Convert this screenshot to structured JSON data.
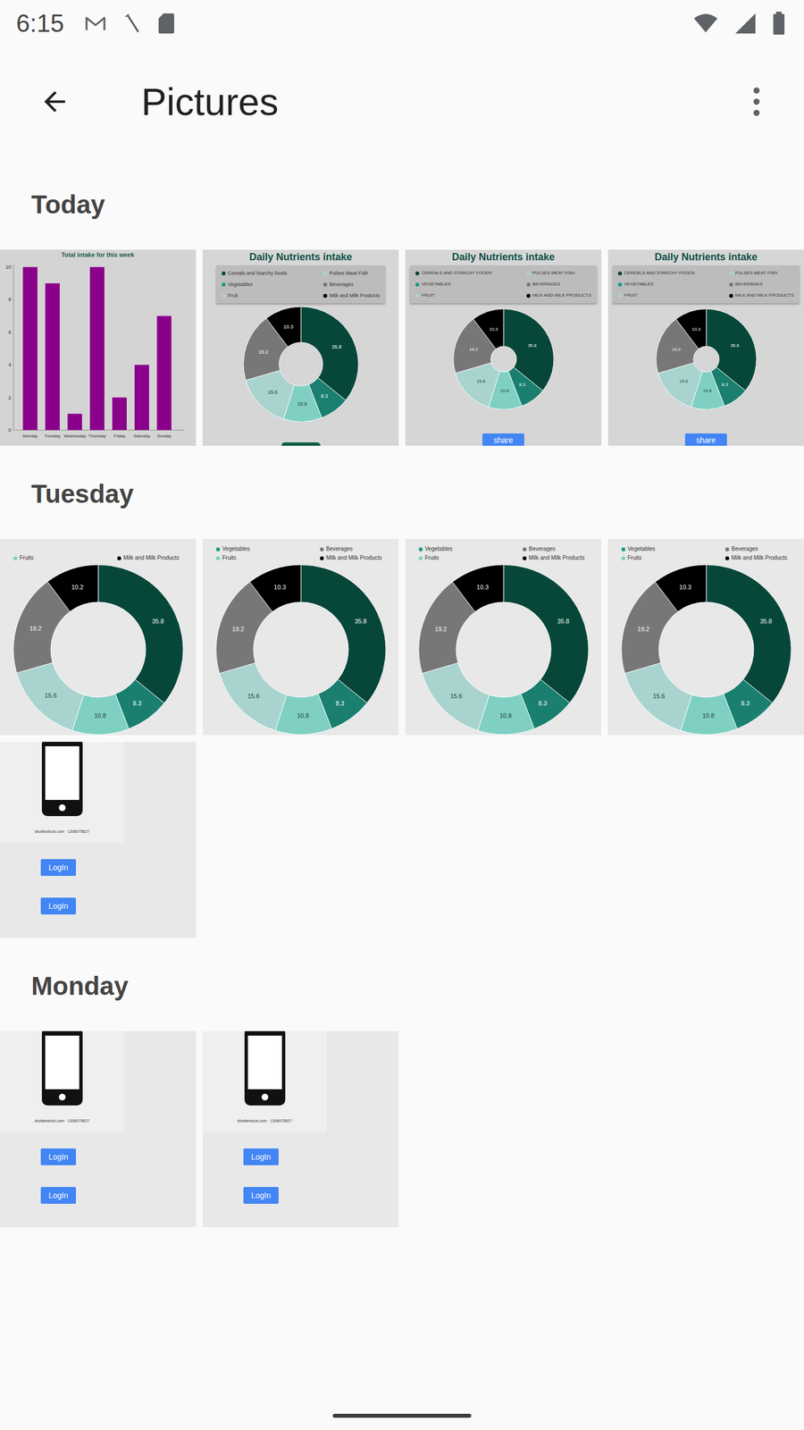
{
  "status_bar": {
    "time": "6:15"
  },
  "toolbar": {
    "title": "Pictures"
  },
  "sections": [
    {
      "title": "Today",
      "items": [
        {
          "kind": "bar-chart",
          "title": "Total intake for this week",
          "y_ticks": [
            "0",
            "2",
            "4",
            "6",
            "8",
            "10"
          ],
          "days": [
            "Monday",
            "Tuesday",
            "Wednesday",
            "Thursday",
            "Friday",
            "Saturday",
            "Sunday"
          ],
          "values": [
            10,
            9,
            1,
            10,
            2,
            4,
            7
          ]
        },
        {
          "kind": "donut-card",
          "title": "Daily Nutrients intake",
          "legend": [
            {
              "label": "Cereals and Starchy foods",
              "color": "#07473a"
            },
            {
              "label": "Pulses Meat Fish",
              "color": "#a9d3cf"
            },
            {
              "label": "Vegetables",
              "color": "#1a9a88"
            },
            {
              "label": "Beverages",
              "color": "#777777"
            },
            {
              "label": "Fruit",
              "color": "#a9d3cf"
            },
            {
              "label": "Milk and Milk Products",
              "color": "#000000"
            }
          ],
          "slices": [
            {
              "value": 35.8,
              "label": "35.8",
              "color": "#07473a"
            },
            {
              "value": 8.3,
              "label": "8.3",
              "color": "#1a7f6f"
            },
            {
              "value": 10.8,
              "label": "10.8",
              "color": "#7fd0c3"
            },
            {
              "value": 15.6,
              "label": "15.6",
              "color": "#a9d3cf"
            },
            {
              "value": 19.2,
              "label": "19.2",
              "color": "#777777"
            },
            {
              "value": 10.3,
              "label": "10.3",
              "color": "#000000"
            }
          ]
        },
        {
          "kind": "donut-share",
          "title": "Daily Nutrients intake",
          "legend": [
            {
              "label": "CEREALS AND STARCHY FOODS",
              "color": "#07473a"
            },
            {
              "label": "PULSES MEAT FISH",
              "color": "#a9d3cf"
            },
            {
              "label": "VEGETABLES",
              "color": "#1a9a88"
            },
            {
              "label": "BEVERAGES",
              "color": "#777777"
            },
            {
              "label": "FRUIT",
              "color": "#a9d3cf"
            },
            {
              "label": "MILK AND MILK PRODUCTS",
              "color": "#000000"
            }
          ],
          "slices": [
            {
              "value": 35.8,
              "label": "35.8",
              "color": "#07473a"
            },
            {
              "value": 8.3,
              "label": "8.3",
              "color": "#1a7f6f"
            },
            {
              "value": 10.8,
              "label": "10.8",
              "color": "#7fd0c3"
            },
            {
              "value": 15.6,
              "label": "15.6",
              "color": "#a9d3cf"
            },
            {
              "value": 19.2,
              "label": "19.2",
              "color": "#777777"
            },
            {
              "value": 10.3,
              "label": "10.3",
              "color": "#000000"
            }
          ],
          "button": "share"
        },
        {
          "kind": "donut-share",
          "title": "Daily Nutrients intake",
          "legend": [
            {
              "label": "CEREALS AND STARCHY FOODS",
              "color": "#07473a"
            },
            {
              "label": "PULSES MEAT FISH",
              "color": "#a9d3cf"
            },
            {
              "label": "VEGETABLES",
              "color": "#1a9a88"
            },
            {
              "label": "BEVERAGES",
              "color": "#777777"
            },
            {
              "label": "FRUIT",
              "color": "#a9d3cf"
            },
            {
              "label": "MILK AND MILK PRODUCTS",
              "color": "#000000"
            }
          ],
          "slices": [
            {
              "value": 35.8,
              "label": "35.8",
              "color": "#07473a"
            },
            {
              "value": 8.3,
              "label": "8.3",
              "color": "#1a7f6f"
            },
            {
              "value": 10.8,
              "label": "10.8",
              "color": "#7fd0c3"
            },
            {
              "value": 15.6,
              "label": "15.6",
              "color": "#a9d3cf"
            },
            {
              "value": 19.2,
              "label": "19.2",
              "color": "#777777"
            },
            {
              "value": 10.3,
              "label": "10.3",
              "color": "#000000"
            }
          ],
          "button": "share"
        }
      ]
    },
    {
      "title": "Tuesday",
      "items": [
        {
          "kind": "donut-zoom",
          "legend": [
            {
              "label": "Fruits",
              "color": "#7fd0c3"
            },
            {
              "label": "Milk and Milk Products",
              "color": "#000000"
            }
          ],
          "slices": [
            {
              "value": 35.8,
              "label": "35.8",
              "color": "#07473a"
            },
            {
              "value": 8.3,
              "label": "8.3",
              "color": "#1a7f6f"
            },
            {
              "value": 10.8,
              "label": "10.8",
              "color": "#7fd0c3"
            },
            {
              "value": 15.6,
              "label": "15.6",
              "color": "#a9d3cf"
            },
            {
              "value": 19.2,
              "label": "19.2",
              "color": "#777777"
            },
            {
              "value": 10.2,
              "label": "10.2",
              "color": "#000000"
            }
          ]
        },
        {
          "kind": "donut-zoom",
          "legend": [
            {
              "label": "Vegetables",
              "color": "#1a9a88"
            },
            {
              "label": "Beverages",
              "color": "#777777"
            },
            {
              "label": "Fruits",
              "color": "#7fd0c3"
            },
            {
              "label": "Milk and Milk Products",
              "color": "#000000"
            }
          ],
          "slices": [
            {
              "value": 35.8,
              "label": "35.8",
              "color": "#07473a"
            },
            {
              "value": 8.3,
              "label": "8.3",
              "color": "#1a7f6f"
            },
            {
              "value": 10.8,
              "label": "10.8",
              "color": "#7fd0c3"
            },
            {
              "value": 15.6,
              "label": "15.6",
              "color": "#a9d3cf"
            },
            {
              "value": 19.2,
              "label": "19.2",
              "color": "#777777"
            },
            {
              "value": 10.3,
              "label": "10.3",
              "color": "#000000"
            }
          ]
        },
        {
          "kind": "donut-zoom",
          "legend": [
            {
              "label": "Vegetables",
              "color": "#1a9a88"
            },
            {
              "label": "Beverages",
              "color": "#777777"
            },
            {
              "label": "Fruits",
              "color": "#7fd0c3"
            },
            {
              "label": "Milk and Milk Products",
              "color": "#000000"
            }
          ],
          "slices": [
            {
              "value": 35.8,
              "label": "35.8",
              "color": "#07473a"
            },
            {
              "value": 8.3,
              "label": "8.3",
              "color": "#1a7f6f"
            },
            {
              "value": 10.8,
              "label": "10.8",
              "color": "#7fd0c3"
            },
            {
              "value": 15.6,
              "label": "15.6",
              "color": "#a9d3cf"
            },
            {
              "value": 19.2,
              "label": "19.2",
              "color": "#777777"
            },
            {
              "value": 10.3,
              "label": "10.3",
              "color": "#000000"
            }
          ]
        },
        {
          "kind": "donut-zoom",
          "legend": [
            {
              "label": "Vegetables",
              "color": "#1a9a88"
            },
            {
              "label": "Beverages",
              "color": "#777777"
            },
            {
              "label": "Fruits",
              "color": "#7fd0c3"
            },
            {
              "label": "Milk and Milk Products",
              "color": "#000000"
            }
          ],
          "slices": [
            {
              "value": 35.8,
              "label": "35.8",
              "color": "#07473a"
            },
            {
              "value": 8.3,
              "label": "8.3",
              "color": "#1a7f6f"
            },
            {
              "value": 10.8,
              "label": "10.8",
              "color": "#7fd0c3"
            },
            {
              "value": 15.6,
              "label": "15.6",
              "color": "#a9d3cf"
            },
            {
              "value": 19.2,
              "label": "19.2",
              "color": "#777777"
            },
            {
              "value": 10.3,
              "label": "10.3",
              "color": "#000000"
            }
          ]
        },
        {
          "kind": "login-screen",
          "caption": "shutterstock.com · 1306075627",
          "buttons": [
            "LogIn",
            "LogIn"
          ]
        }
      ]
    },
    {
      "title": "Monday",
      "items": [
        {
          "kind": "login-screen",
          "caption": "shutterstock.com · 1306075627",
          "buttons": [
            "LogIn",
            "LogIn"
          ]
        },
        {
          "kind": "login-screen",
          "caption": "shutterstock.com · 1306075627",
          "buttons": [
            "LogIn",
            "LogIn"
          ]
        }
      ]
    }
  ]
}
